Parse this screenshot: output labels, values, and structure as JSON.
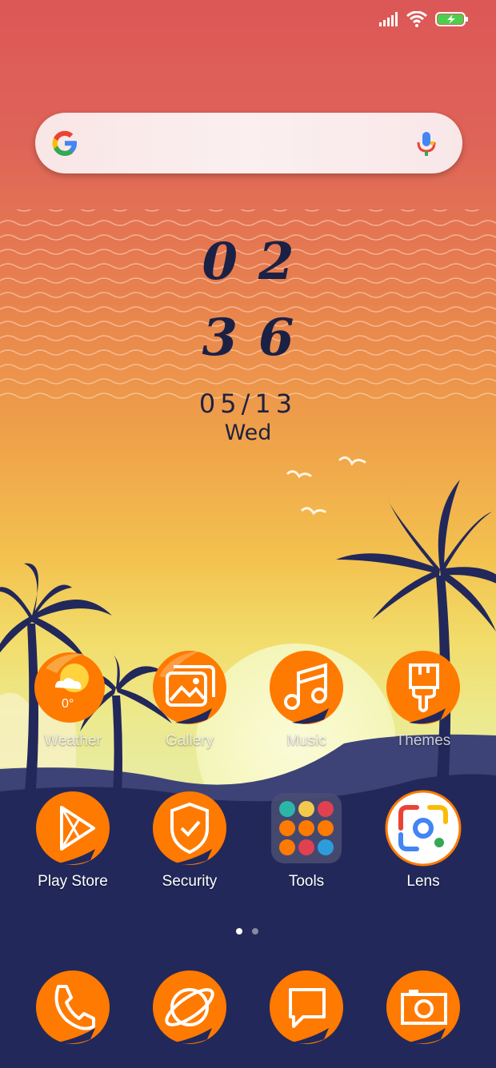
{
  "status_bar": {
    "signal_icon": "signal-icon",
    "wifi_icon": "wifi-icon",
    "battery_icon": "battery-charging-icon"
  },
  "search_bar": {
    "placeholder": "",
    "logo": "google-g-icon",
    "mic": "mic-icon"
  },
  "clock": {
    "hours": "02",
    "minutes": "36",
    "date": "05/13",
    "weekday": "Wed"
  },
  "weather": {
    "temperature": "0°"
  },
  "apps_row1": [
    {
      "label": "Weather",
      "icon": "weather-icon"
    },
    {
      "label": "Gallery",
      "icon": "gallery-icon"
    },
    {
      "label": "Music",
      "icon": "music-icon"
    },
    {
      "label": "Themes",
      "icon": "themes-icon"
    }
  ],
  "apps_row2": [
    {
      "label": "Play Store",
      "icon": "play-store-icon"
    },
    {
      "label": "Security",
      "icon": "security-icon"
    },
    {
      "label": "Tools",
      "icon": "tools-folder-icon"
    },
    {
      "label": "Lens",
      "icon": "lens-icon"
    }
  ],
  "dock": [
    {
      "icon": "phone-icon"
    },
    {
      "icon": "browser-icon"
    },
    {
      "icon": "messages-icon"
    },
    {
      "icon": "camera-icon"
    }
  ],
  "page_indicator": {
    "pages": 2,
    "current": 1
  },
  "colors": {
    "icon_orange": "#ff7a00",
    "night_blue": "#22285a",
    "clock_ink": "#1b2145"
  }
}
